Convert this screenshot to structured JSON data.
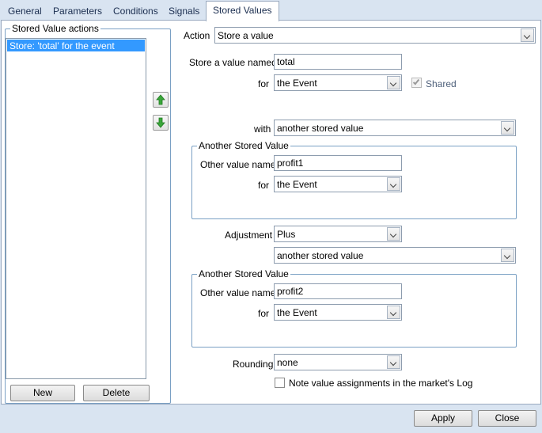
{
  "tabs": [
    {
      "label": "General"
    },
    {
      "label": "Parameters"
    },
    {
      "label": "Conditions"
    },
    {
      "label": "Signals"
    },
    {
      "label": "Stored Values"
    }
  ],
  "active_tab": "Stored Values",
  "left_panel": {
    "title": "Stored Value actions",
    "items": [
      {
        "label": "Store: 'total' for the event",
        "selected": true
      }
    ],
    "new_label": "New",
    "delete_label": "Delete",
    "move_up_icon": "arrow-up-icon",
    "move_down_icon": "arrow-down-icon"
  },
  "form": {
    "action_label": "Action",
    "action_value": "Store a value",
    "store_named_label": "Store a value named",
    "store_named_value": "total",
    "for_label": "for",
    "for_value": "the Event",
    "shared_label": "Shared",
    "shared_checked": true,
    "with_label": "with",
    "with_value": "another stored value",
    "group1": {
      "title": "Another Stored Value",
      "name_label": "Other value name",
      "name_value": "profit1",
      "for_label": "for",
      "for_value": "the Event"
    },
    "adjustment_label": "Adjustment",
    "adjustment_value": "Plus",
    "adjustment_with_value": "another stored value",
    "group2": {
      "title": "Another Stored Value",
      "name_label": "Other value name",
      "name_value": "profit2",
      "for_label": "for",
      "for_value": "the Event"
    },
    "rounding_label": "Rounding",
    "rounding_value": "none",
    "note_label": "Note value assignments in the market's Log",
    "note_checked": false
  },
  "footer": {
    "apply_label": "Apply",
    "close_label": "Close"
  },
  "colors": {
    "selection": "#3399ff",
    "chrome": "#d9e4f1",
    "group_border": "#7aa0c4",
    "arrow_green": "#3aa63a"
  }
}
